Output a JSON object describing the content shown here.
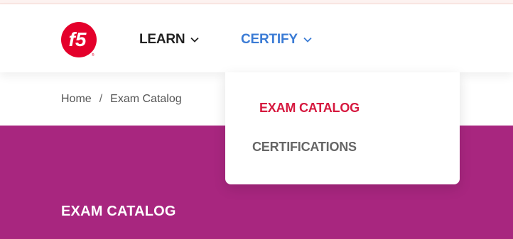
{
  "nav": {
    "logo_text": "f5",
    "items": [
      {
        "label": "LEARN",
        "active": false
      },
      {
        "label": "CERTIFY",
        "active": true
      }
    ]
  },
  "breadcrumb": {
    "home": "Home",
    "separator": "/",
    "current": "Exam Catalog"
  },
  "dropdown": {
    "items": [
      {
        "label": "EXAM CATALOG",
        "active": true
      },
      {
        "label": "CERTIFICATIONS",
        "active": false
      }
    ]
  },
  "hero": {
    "title": "EXAM CATALOG"
  },
  "colors": {
    "brand_red": "#e4002b",
    "active_nav_blue": "#3a7bd5",
    "active_menu_red": "#d6193f",
    "hero_magenta": "#a8267f"
  },
  "icons": {
    "logo": "f5-logo",
    "nav_chevron": "chevron-down-icon"
  }
}
